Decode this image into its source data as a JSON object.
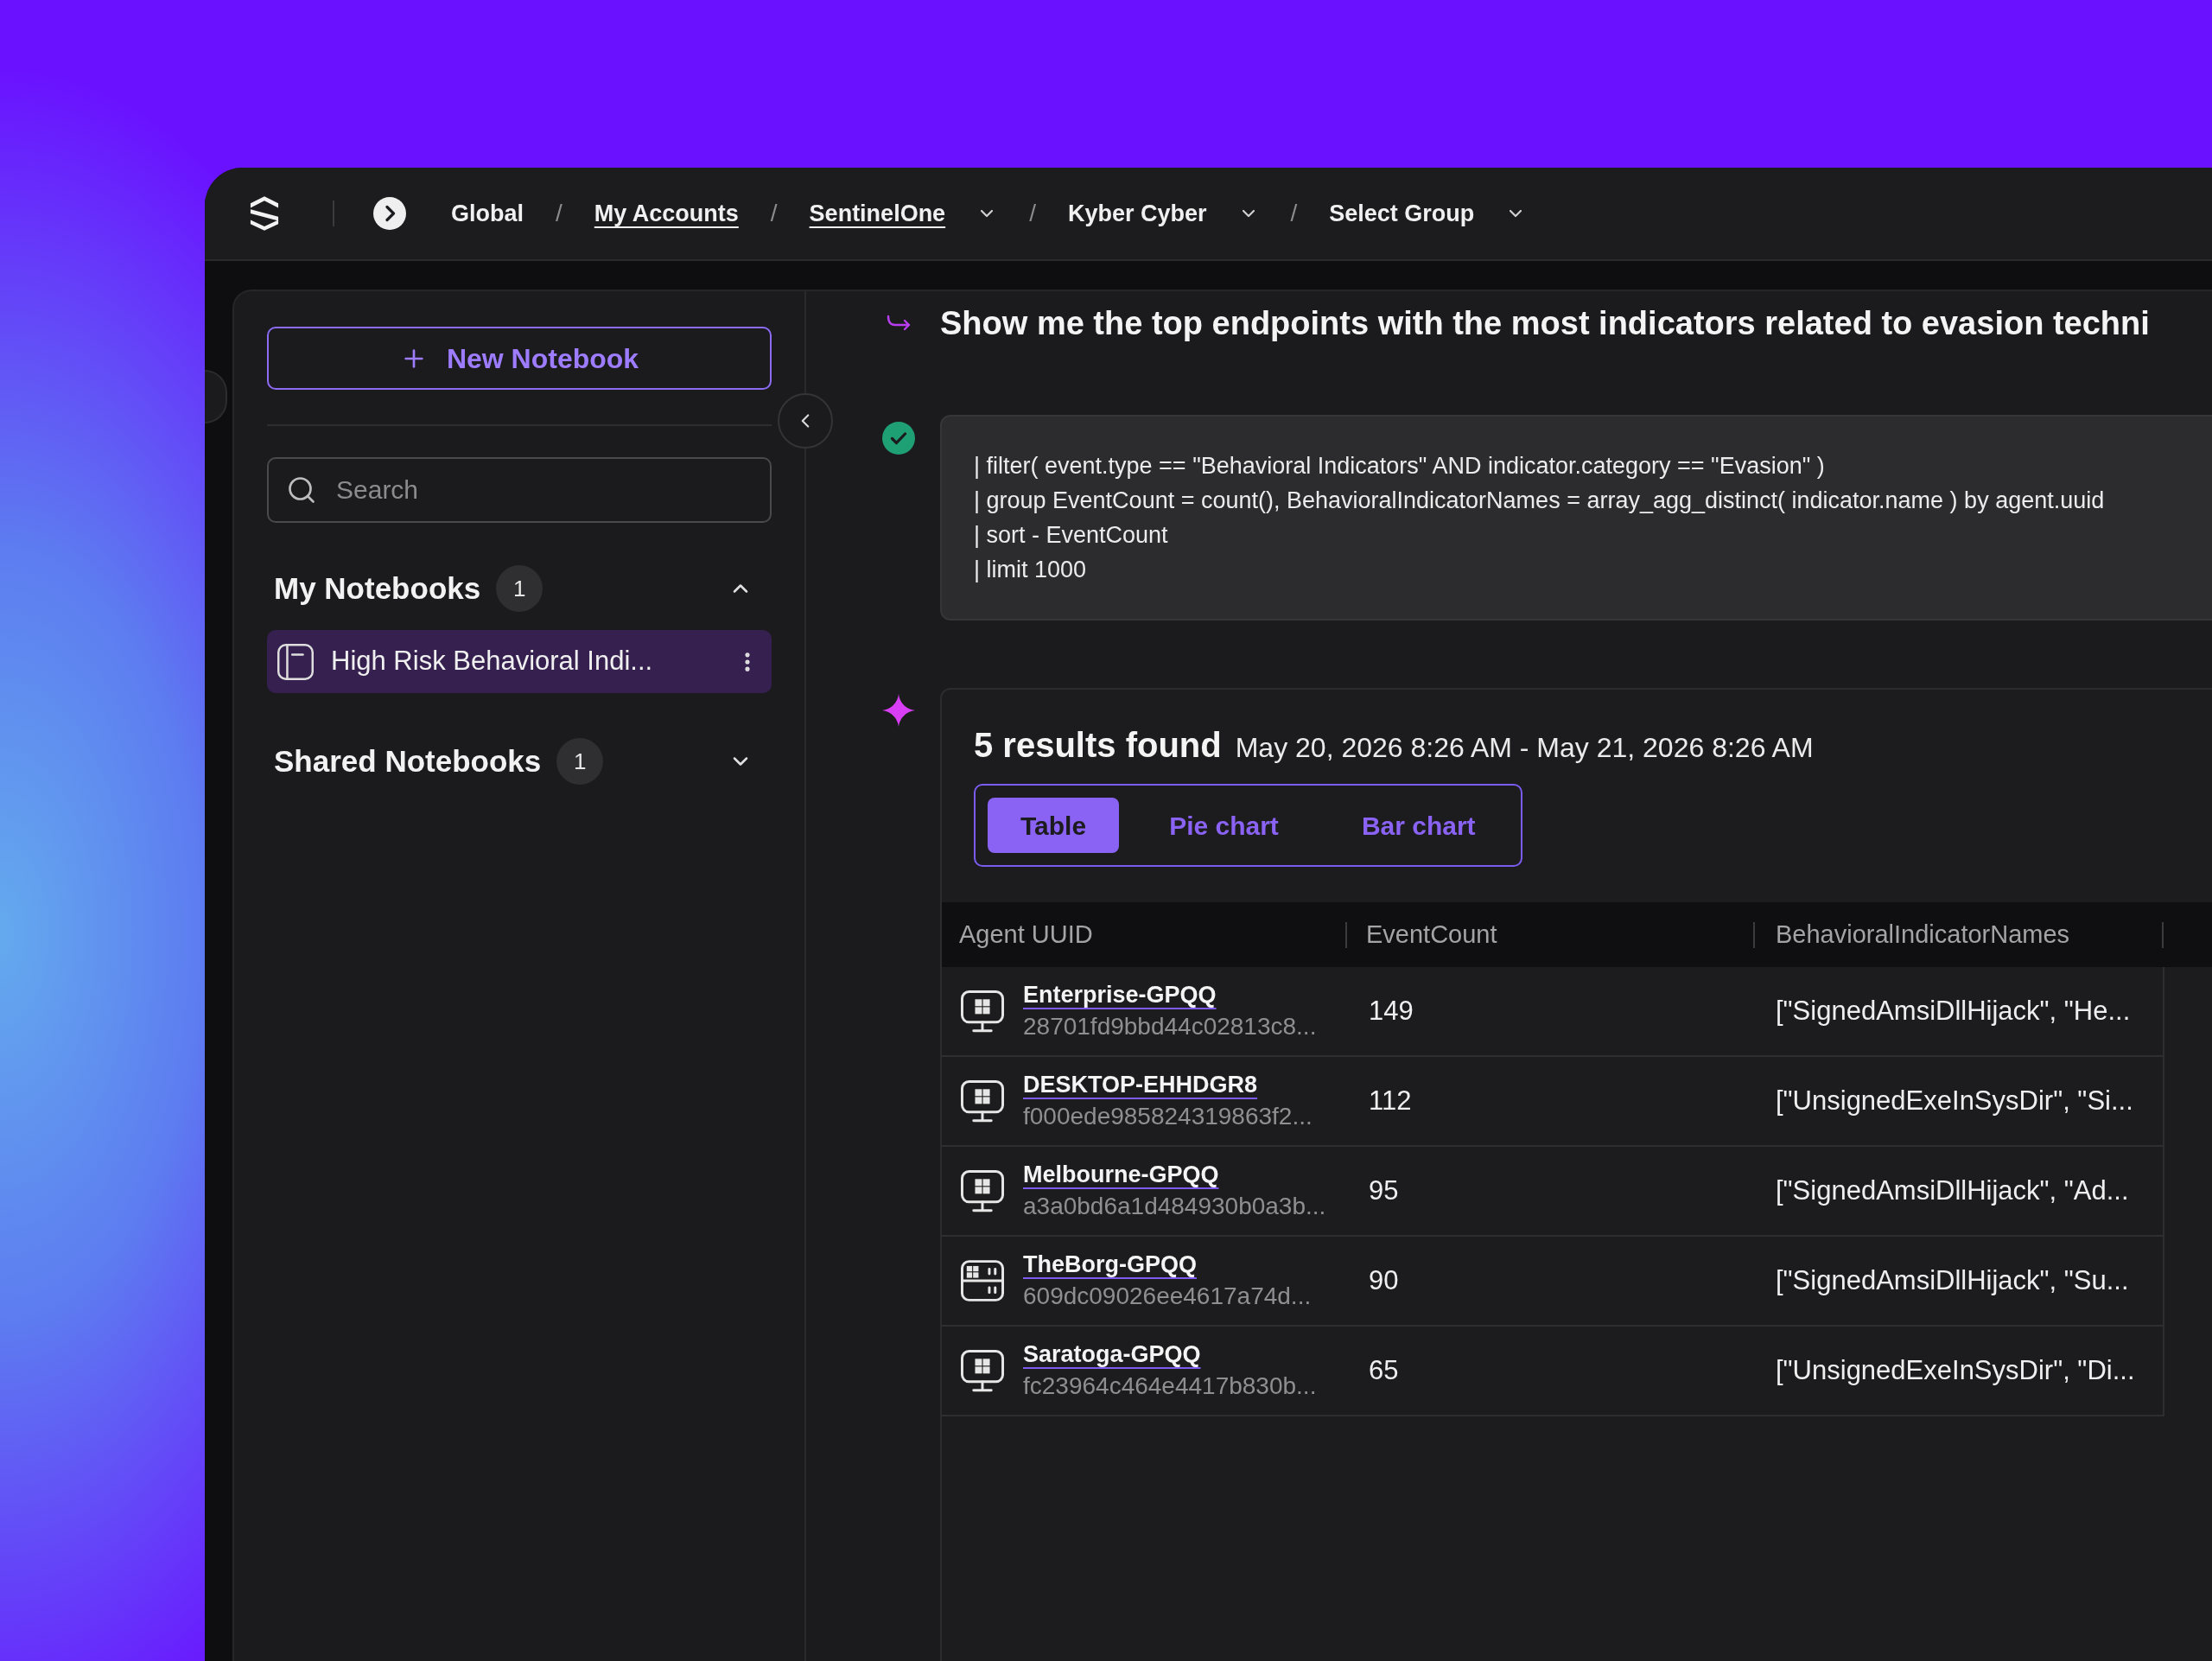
{
  "breadcrumb": {
    "items": [
      {
        "label": "Global",
        "link": false,
        "dropdown": false
      },
      {
        "separator": "/",
        "label": "My Accounts",
        "link": true,
        "dropdown": false
      },
      {
        "separator": "/",
        "label": "SentinelOne",
        "link": true,
        "dropdown": true
      },
      {
        "separator": "/",
        "label": "Kyber Cyber",
        "link": false,
        "dropdown": true
      },
      {
        "separator": "/",
        "label": "Select Group",
        "link": false,
        "dropdown": true
      }
    ]
  },
  "sidebar": {
    "new_button": {
      "label": "New Notebook"
    },
    "search": {
      "placeholder": "Search"
    },
    "sections": [
      {
        "title": "My Notebooks",
        "count": "1",
        "expanded": true,
        "items": [
          {
            "label": "High Risk Behavioral Indi...",
            "selected": true
          }
        ]
      },
      {
        "title": "Shared Notebooks",
        "count": "1",
        "expanded": false
      }
    ]
  },
  "conversation": {
    "prompt": "Show me the top endpoints with the most indicators related to evasion techni",
    "query": {
      "succeeded": true,
      "lines": [
        "| filter( event.type == \"Behavioral Indicators\" AND indicator.category == \"Evasion\" )",
        "| group EventCount = count(), BehavioralIndicatorNames = array_agg_distinct( indicator.name ) by agent.uuid",
        "| sort - EventCount",
        "| limit 1000"
      ]
    },
    "results": {
      "summary": "5 results found",
      "time_range": "May 20, 2026 8:26 AM - May 21, 2026 8:26 AM",
      "views": [
        {
          "label": "Table",
          "selected": true
        },
        {
          "label": "Pie chart",
          "selected": false
        },
        {
          "label": "Bar chart",
          "selected": false
        }
      ],
      "table": {
        "columns": [
          "Agent UUID",
          "EventCount",
          "BehavioralIndicatorNames"
        ],
        "rows": [
          {
            "kind": "desktop",
            "name": "Enterprise-GPQQ",
            "uuid": "28701fd9bbd44c02813c8...",
            "event_count": "149",
            "indicator_names": "[\"SignedAmsiDllHijack\", \"He..."
          },
          {
            "kind": "desktop",
            "name": "DESKTOP-EHHDGR8",
            "uuid": "f000ede985824319863f2...",
            "event_count": "112",
            "indicator_names": "[\"UnsignedExeInSysDir\", \"Si..."
          },
          {
            "kind": "desktop",
            "name": "Melbourne-GPQQ",
            "uuid": "a3a0bd6a1d484930b0a3b...",
            "event_count": "95",
            "indicator_names": "[\"SignedAmsiDllHijack\", \"Ad..."
          },
          {
            "kind": "server",
            "name": "TheBorg-GPQQ",
            "uuid": "609dc09026ee4617a74d...",
            "event_count": "90",
            "indicator_names": "[\"SignedAmsiDllHijack\", \"Su..."
          },
          {
            "kind": "desktop",
            "name": "Saratoga-GPQQ",
            "uuid": "fc23964c464e4417b830b...",
            "event_count": "65",
            "indicator_names": "[\"UnsignedExeInSysDir\", \"Di..."
          }
        ]
      }
    }
  }
}
